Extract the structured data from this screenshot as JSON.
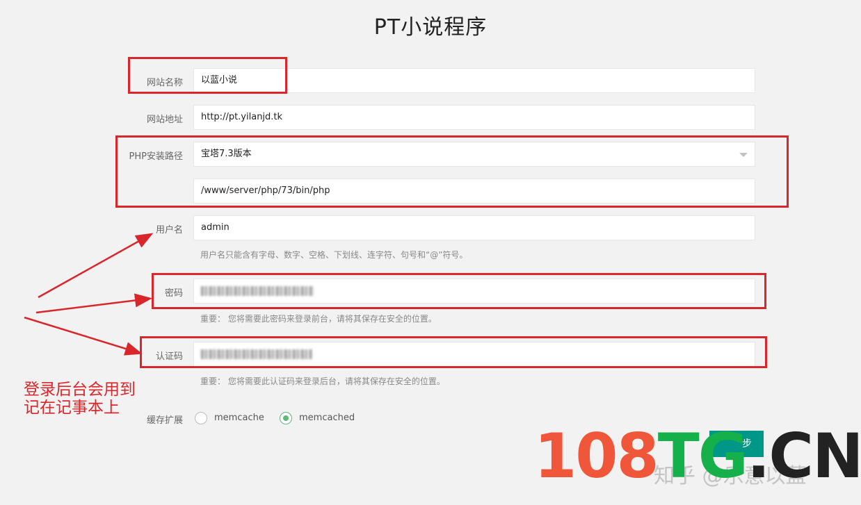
{
  "page": {
    "title": "PT小说程序"
  },
  "form": {
    "site_name": {
      "label": "网站名称",
      "value": "以蓝小说"
    },
    "site_url": {
      "label": "网站地址",
      "value": "http://pt.yilanjd.tk"
    },
    "php_path": {
      "label": "PHP安装路径",
      "selected": "宝塔7.3版本",
      "path_value": "/www/server/php/73/bin/php"
    },
    "username": {
      "label": "用户名",
      "value": "admin",
      "hint": "用户名只能含有字母、数字、空格、下划线、连字符、句号和“@”符号。"
    },
    "password": {
      "label": "密码",
      "hint": "重要： 您将需要此密码来登录前台，请将其保存在安全的位置。"
    },
    "auth_code": {
      "label": "认证码",
      "hint": "重要： 您将需要此认证码来登录后台，请将其保存在安全的位置。"
    },
    "cache": {
      "label": "缓存扩展",
      "options": [
        {
          "label": "memcache",
          "checked": false
        },
        {
          "label": "memcached",
          "checked": true
        }
      ]
    },
    "next_button": {
      "label": "步"
    }
  },
  "annotation": {
    "line1": "登录后台会用到",
    "line2": "记在记事本上"
  },
  "watermark": {
    "num": "108",
    "tg": "TG",
    "cn": ".CN",
    "zhihu": "知乎 @乐意以蓝"
  },
  "colors": {
    "accent": "#009688",
    "radio": "#5fb878",
    "annotation": "#d8262b"
  }
}
